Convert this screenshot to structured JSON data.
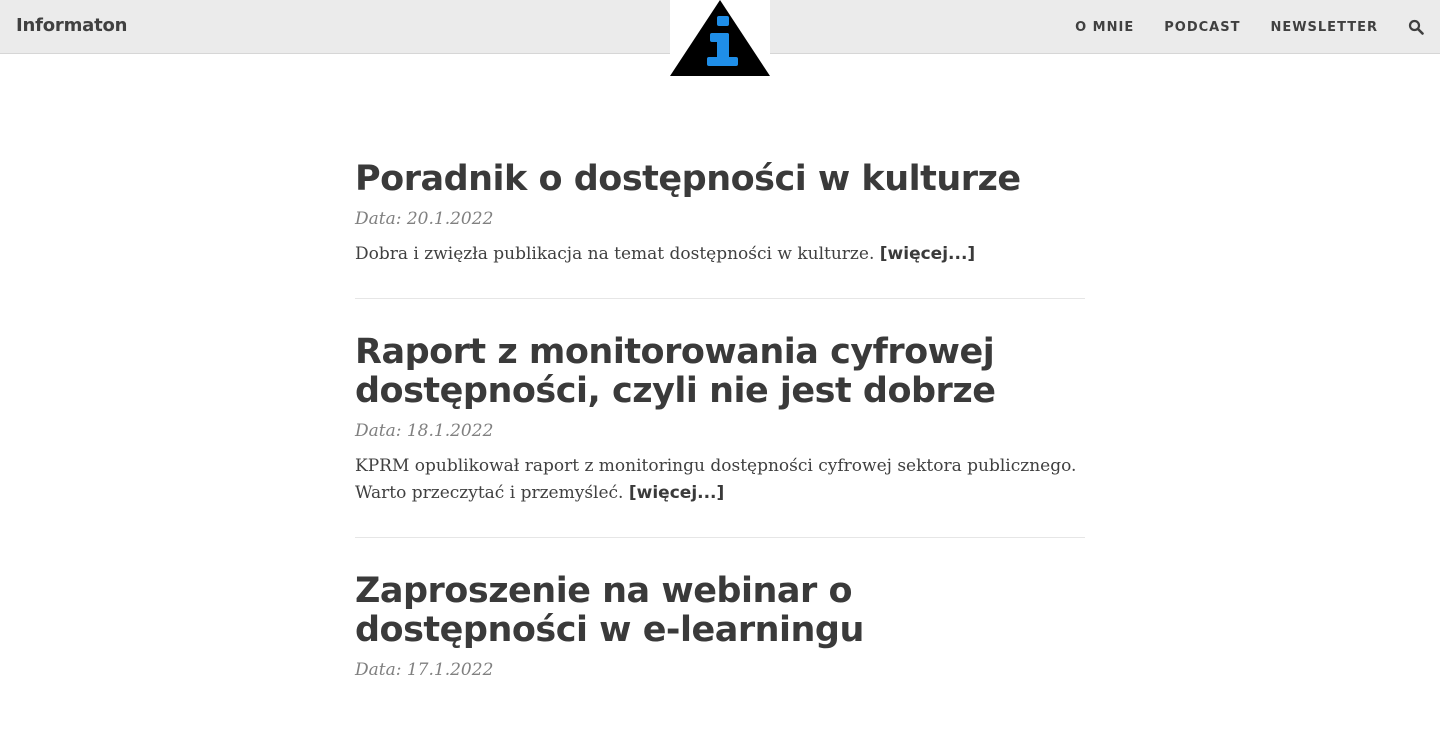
{
  "header": {
    "brand": "Informaton",
    "nav": [
      {
        "label": "O MNIE"
      },
      {
        "label": "PODCAST"
      },
      {
        "label": "NEWSLETTER"
      }
    ],
    "logo_colors": {
      "triangle": "#000000",
      "letter": "#1f8ee8"
    }
  },
  "posts": [
    {
      "title": "Poradnik o dostępności w kulturze",
      "date": "Data: 20.1.2022",
      "excerpt": "Dobra i zwięzła publikacja na temat dostępności w kulturze.",
      "more": "[więcej...]"
    },
    {
      "title": "Raport z monitorowania cyfrowej dostępności, czyli nie jest dobrze",
      "date": "Data: 18.1.2022",
      "excerpt": "KPRM opublikował raport z monitoringu dostępności cyfrowej sektora publicznego. Warto przeczytać i przemyśleć.",
      "more": "[więcej...]"
    },
    {
      "title": "Zaproszenie na webinar o dostępności w e-learningu",
      "date": "Data: 17.1.2022",
      "excerpt": "",
      "more": ""
    }
  ]
}
